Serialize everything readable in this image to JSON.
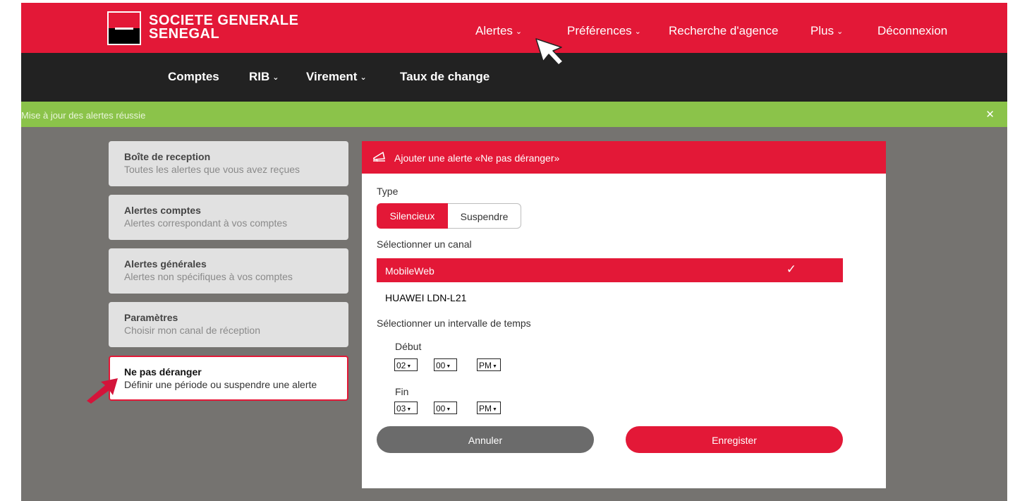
{
  "brand": {
    "line1": "SOCIETE GENERALE",
    "line2": "SENEGAL",
    "logo_icon": "societe-generale-logo"
  },
  "topnav": {
    "items": [
      {
        "label": "Alertes",
        "chevron": "⌄"
      },
      {
        "label": "Préférences",
        "chevron": "⌄"
      },
      {
        "label": "Recherche d'agence"
      },
      {
        "label": "Plus",
        "chevron": "⌄"
      },
      {
        "label": "Déconnexion"
      }
    ]
  },
  "subnav": {
    "items": [
      {
        "label": "Comptes"
      },
      {
        "label": "RIB",
        "chevron": "⌄"
      },
      {
        "label": "Virement",
        "chevron": "⌄"
      },
      {
        "label": "Taux de change"
      }
    ]
  },
  "message": {
    "text": "Mise à jour des alertes réussie",
    "close": "✕"
  },
  "sidebar": {
    "items": [
      {
        "title": "Boîte de reception",
        "subtitle": "Toutes les alertes que vous avez reçues"
      },
      {
        "title": "Alertes comptes",
        "subtitle": "Alertes correspondant à vos comptes"
      },
      {
        "title": "Alertes générales",
        "subtitle": "Alertes non spécifiques à vos comptes"
      },
      {
        "title": "Paramètres",
        "subtitle": "Choisir mon canal de réception"
      },
      {
        "title": "Ne pas déranger",
        "subtitle": "Définir une période ou suspendre une alerte",
        "active": true
      }
    ]
  },
  "panel": {
    "title": "Ajouter une alerte «Ne pas déranger»",
    "title_icon": "megaphone-icon",
    "type_label": "Type",
    "type_options": [
      "Silencieux",
      "Suspendre"
    ],
    "type_selected": "Silencieux",
    "channel_label": "Sélectionner un canal",
    "channels": [
      {
        "name": "MobileWeb",
        "selected": true,
        "check": "✓"
      },
      {
        "name": "HUAWEI LDN-L21",
        "selected": false
      }
    ],
    "interval_label": "Sélectionner un intervalle de temps",
    "start": {
      "label": "Début",
      "hour": "02",
      "minute": "00",
      "ampm": "PM"
    },
    "end": {
      "label": "Fin",
      "hour": "03",
      "minute": "00",
      "ampm": "PM"
    },
    "dropdown_arrow": "▼",
    "cancel_label": "Annuler",
    "save_label": "Enregister"
  },
  "colors": {
    "brand_red": "#e31837",
    "dark": "#222222",
    "success_green": "#8bc34a",
    "backdrop": "#757370"
  }
}
